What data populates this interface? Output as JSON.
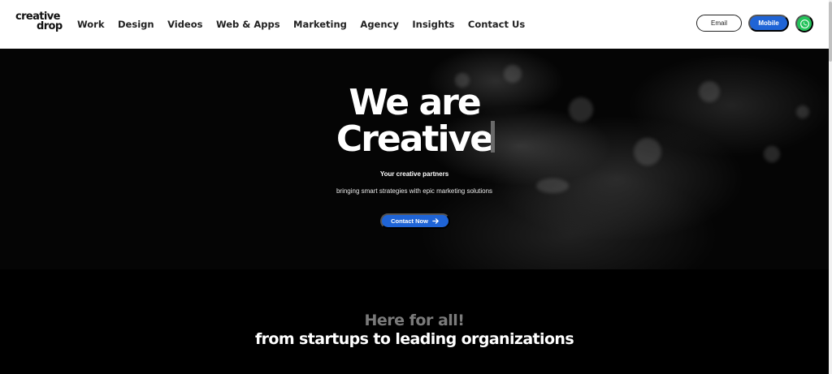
{
  "header": {
    "logo": {
      "line1": "creative",
      "line2": "drop"
    },
    "nav": [
      "Work",
      "Design",
      "Videos",
      "Web & Apps",
      "Marketing",
      "Agency",
      "Insights",
      "Contact Us"
    ],
    "email_label": "Email",
    "mobile_label": "Mobile",
    "whatsapp_icon": "whatsapp-icon"
  },
  "hero": {
    "title_line1": "We are",
    "title_line2": "Creative",
    "tagline": "Your creative partners",
    "subline": "bringing smart strategies with epic marketing solutions",
    "cta_label": "Contact Now"
  },
  "section": {
    "heading_muted": "Here for all!",
    "heading_main": "from startups to leading organizations"
  },
  "colors": {
    "accent": "#1f64d6",
    "whatsapp": "#23c35a",
    "background": "#000000"
  }
}
